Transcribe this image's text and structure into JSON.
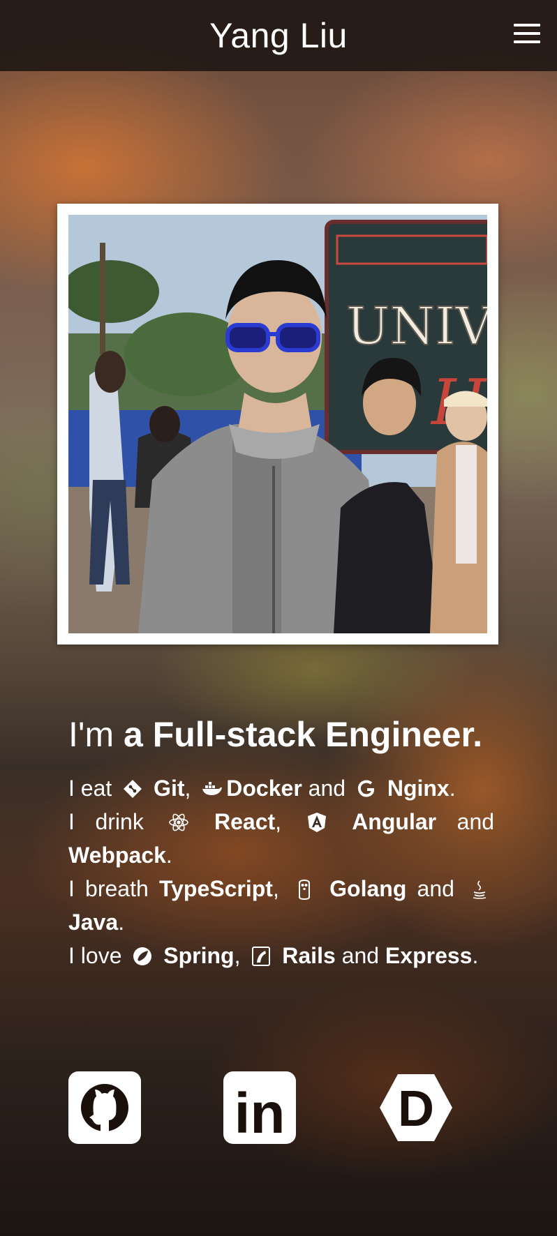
{
  "header": {
    "title": "Yang Liu",
    "menu_icon": "hamburger-menu-icon"
  },
  "profile": {
    "photo_sign_text": "UNIVER",
    "photo_sign_letter": "H"
  },
  "intro": {
    "headline_prefix": "I'm",
    "headline_article": "a",
    "headline_role": "Full-stack Engineer."
  },
  "stack": {
    "line1": {
      "verb": "I eat",
      "items": [
        "Git",
        "Docker",
        "Nginx"
      ],
      "icons": [
        "git-icon",
        "docker-icon",
        "nginx-icon"
      ]
    },
    "line2": {
      "verb": "I drink",
      "items": [
        "React",
        "Angular",
        "Webpack"
      ],
      "icons": [
        "react-icon",
        "angular-icon"
      ]
    },
    "line3": {
      "verb": "I breath",
      "items": [
        "TypeScript",
        "Golang",
        "Java"
      ],
      "icons": [
        "golang-gopher-icon",
        "java-icon"
      ]
    },
    "line4": {
      "verb": "I love",
      "items": [
        "Spring",
        "Rails",
        "Express"
      ],
      "icons": [
        "spring-icon",
        "rails-icon"
      ]
    },
    "separator_comma": ",",
    "conjunction": "and",
    "terminator": "."
  },
  "social": [
    {
      "name": "GitHub",
      "icon": "github-icon"
    },
    {
      "name": "LinkedIn",
      "icon": "linkedin-icon",
      "glyph": "in"
    },
    {
      "name": "DEV",
      "icon": "dev-icon",
      "glyph": "D"
    }
  ],
  "colors": {
    "header_bg": "#1e1612",
    "text": "#ffffff",
    "social_icon_fg": "#1a0f0a"
  }
}
